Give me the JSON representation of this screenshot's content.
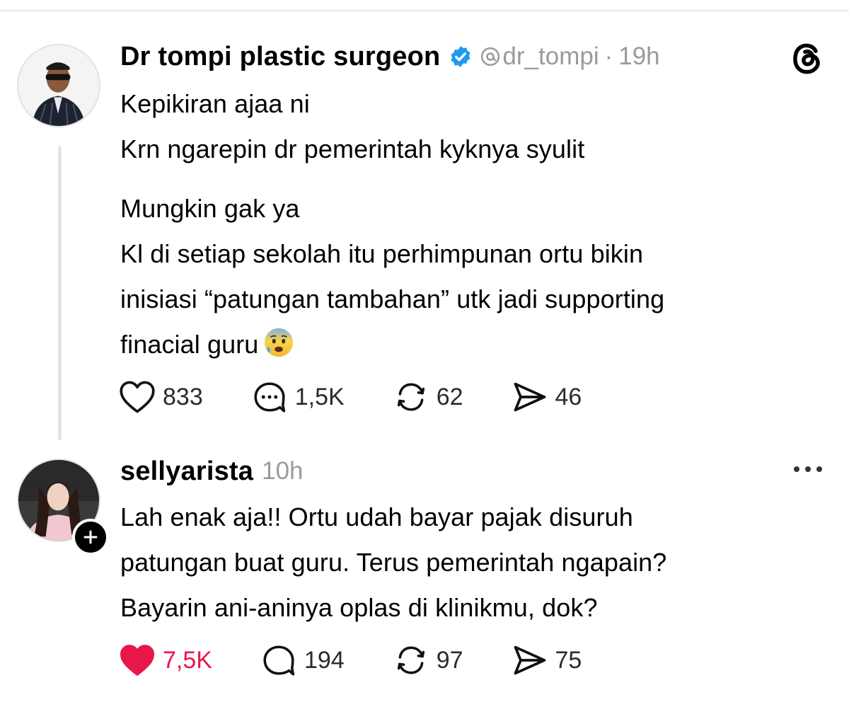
{
  "post": {
    "author": "Dr tompi plastic surgeon",
    "handle": "dr_tompi",
    "time": "19h",
    "lines": [
      "Kepikiran ajaa ni",
      "Krn ngarepin dr pemerintah kyknya syulit",
      "",
      "Mungkin gak ya",
      "Kl di setiap sekolah itu perhimpunan ortu bikin",
      "inisiasi “patungan tambahan” utk jadi supporting",
      "finacial guru"
    ],
    "trailing_emoji": "anxious-face-with-sweat",
    "stats": {
      "likes": "833",
      "replies": "1,5K",
      "reposts": "62",
      "shares": "46"
    }
  },
  "reply": {
    "author": "sellyarista",
    "time": "10h",
    "lines": [
      "Lah enak aja!! Ortu udah bayar pajak disuruh",
      "patungan buat guru. Terus pemerintah ngapain?",
      "Bayarin ani-aninya oplas di klinikmu, dok?"
    ],
    "liked": true,
    "stats": {
      "likes": "7,5K",
      "replies": "194",
      "reposts": "97",
      "shares": "75"
    }
  },
  "colors": {
    "verified": "#1d9bf0",
    "like_active": "#e8174a",
    "meta_gray": "#9a9a9a"
  },
  "icons": [
    "threads-logo-icon",
    "verified-badge-icon",
    "heart-icon",
    "comment-icon",
    "repost-icon",
    "share-icon",
    "more-icon",
    "plus-icon"
  ]
}
